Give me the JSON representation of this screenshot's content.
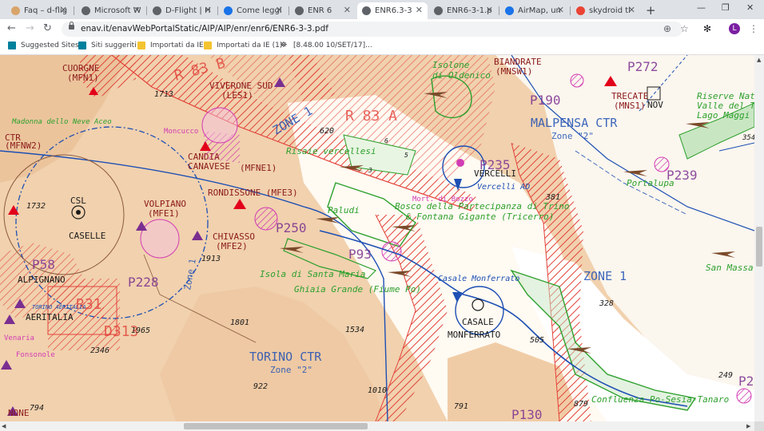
{
  "browser": {
    "tabs": [
      {
        "title": "Faq – d-flig",
        "fav": "#d9a46a"
      },
      {
        "title": "Microsoft W",
        "fav": "#5f6368"
      },
      {
        "title": "D-Flight | H",
        "fav": "#5f6368"
      },
      {
        "title": "Come leggi",
        "fav": "#1a73e8"
      },
      {
        "title": "ENR 6",
        "fav": "#5f6368"
      },
      {
        "title": "ENR6.3-3",
        "fav": "#5f6368"
      },
      {
        "title": "ENR6-3-1.p",
        "fav": "#5f6368"
      },
      {
        "title": "AirMap, un",
        "fav": "#1a73e8"
      },
      {
        "title": "skydroid tl",
        "fav": "#ea4335"
      }
    ],
    "active_tab_index": 5,
    "url": "enav.it/enavWebPortalStatic/AIP/AIP/enr/enr6/ENR6-3-3.pdf",
    "avatar_letter": "L",
    "bookmarks": [
      {
        "label": "Suggested Sites",
        "icon": "bing-icon"
      },
      {
        "label": "Siti suggeriti",
        "icon": "bing-icon"
      },
      {
        "label": "Importati da IE",
        "icon": "folder-icon"
      },
      {
        "label": "Importati da IE (1)",
        "icon": "folder-icon"
      },
      {
        "label": "[8.48.00 10/SET/17]...",
        "icon": "satellite-icon"
      }
    ]
  },
  "map": {
    "colors": {
      "terrain": "#f1d1ae",
      "plain": "#ffffff",
      "water": "#1d4fb4",
      "restricted": "#e2433a",
      "green": "#2da02d",
      "purple": "#7a2e90",
      "magenta": "#d23cb4"
    },
    "labels": {
      "cuorgne": "CUORGNE",
      "mfn1": "(MFN1)",
      "viverone_sud": "VIVERONE SUD",
      "les1": "(LES1)",
      "r83b": "R 83 B",
      "r83a": "R 83 A",
      "zone1_top": "ZONE 1",
      "isolone": "Isolone",
      "di_oldenico": "di Oldenico",
      "biandrate": "BIANDRATE",
      "mnsw1": "(MNSW1)",
      "p190": "P190",
      "trecate": "TRECATE",
      "mns1": "(MNS1)",
      "nov": "NOV",
      "p272": "P272",
      "riserve_1": "Riserve Nat",
      "riserve_2": "Valle del Ti",
      "riserve_3": "Lago Maggi",
      "malpensa_ctr": "MALPENSA CTR",
      "zone2_malpensa": "Zone \"2\"",
      "ctr_left": "CTR",
      "mfnw2": "(MFNW2)",
      "madonna": "Madonna dello Neve Aceo",
      "moncucco": "Moncucco",
      "candia_1": "CANDIA",
      "candia_2": "CANAVESE",
      "mfne1": "(MFNE1)",
      "risaie": "Risaie vercellesi",
      "p235": "P235",
      "vercelli": "VERCELLI",
      "vercelli_ad": "Vercelli AD",
      "p239": "P239",
      "portalupa": "Portalupa",
      "csl": "CSL",
      "caselle": "CASELLE",
      "rondissone": "RONDISSONE (MFE3)",
      "volpiano": "VOLPIANO",
      "mfe1": "(MFE1)",
      "chivasso": "CHIVASSO",
      "mfe2": "(MFE2)",
      "p250": "P250",
      "p93": "P93",
      "paludi": "Paludi",
      "bosco_1": "Bosco della Partecipanza di Trino",
      "bosco_2": "& Fontana Gigante (Tricerro)",
      "morti_bozzo": "Mort. di Bozzo",
      "p58": "P58",
      "alpignano": "ALPIGNANO",
      "aeritalia": "AERITALIA",
      "torino_aer": "TORINO AERITALIA",
      "r31": "R31",
      "p228": "P228",
      "zone1_left": "Zone 1",
      "d313": "D313",
      "isola": "Isola di Santa Maria",
      "ghiaia": "Ghiaia Grande (Fiume Po)",
      "casale_monferrato": "Casale Monferrato",
      "casale": "CASALE",
      "monferrato": "MONFERRATO",
      "zone1_right": "ZONE 1",
      "san_masso": "San Massa",
      "torino_ctr": "TORINO CTR",
      "zone2_torino": "Zone \"2\"",
      "confluenza": "Confluenza Po-Sesia-Tanaro",
      "p130": "P130",
      "none": "NONE",
      "venaria": "Venaria",
      "fonsonole": "Fonsonole",
      "p2": "P2"
    },
    "elevations": {
      "e1713": "1713",
      "e620": "620",
      "e1732": "1732",
      "e1913": "1913",
      "e381": "381",
      "e1801": "1801",
      "e1534": "1534",
      "e1965": "1965",
      "e2346": "2346",
      "e328": "328",
      "e505": "505",
      "e922": "922",
      "e1010": "1010",
      "e791": "791",
      "e879": "879",
      "e794": "794",
      "e249": "249",
      "e354": "354",
      "e3": "3",
      "e6": "6",
      "e5": "5"
    }
  }
}
